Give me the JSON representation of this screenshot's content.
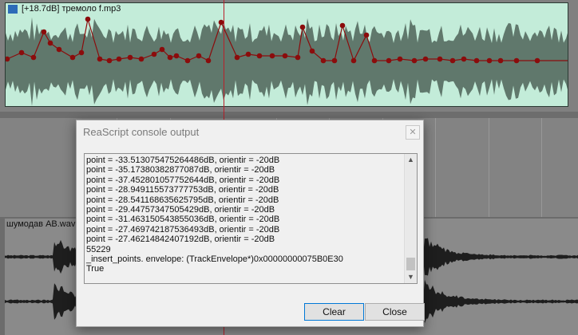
{
  "track1": {
    "item_label": "[+18.7dB] тремоло f.mp3"
  },
  "track2": {
    "item_label": "шумодав АВ.wav"
  },
  "dialog": {
    "title": "ReaScript console output",
    "close_glyph": "✕",
    "console_lines": [
      "point = -33.513075475264486dB, orientir = -20dB",
      "point = -35.17380382877087dB, orientir = -20dB",
      "point = -37.452801057752644dB, orientir = -20dB",
      "point = -28.949115573777753dB, orientir = -20dB",
      "point = -28.541168635625795dB, orientir = -20dB",
      "point = -29.44757347505429dB, orientir = -20dB",
      "point = -31.463150543855036dB, orientir = -20dB",
      "point = -27.469742187536493dB, orientir = -20dB",
      "point = -27.46214842407192dB, orientir = -20dB",
      "55229",
      "_insert_points. envelope: (TrackEnvelope*)0x00000000075B0E30",
      "True"
    ],
    "clear_label": "Clear",
    "close_label": "Close"
  },
  "colors": {
    "item1_bg": "#c3ecd9",
    "item1_wave": "#60786c",
    "envelope": "#8b0c0c",
    "item2_wave": "#1e1e1e",
    "edit_cursor": "#b8202a"
  },
  "icons": {
    "item_icon": "reaper-item-icon",
    "scroll_up": "chevron-up-icon",
    "scroll_down": "chevron-down-icon"
  }
}
